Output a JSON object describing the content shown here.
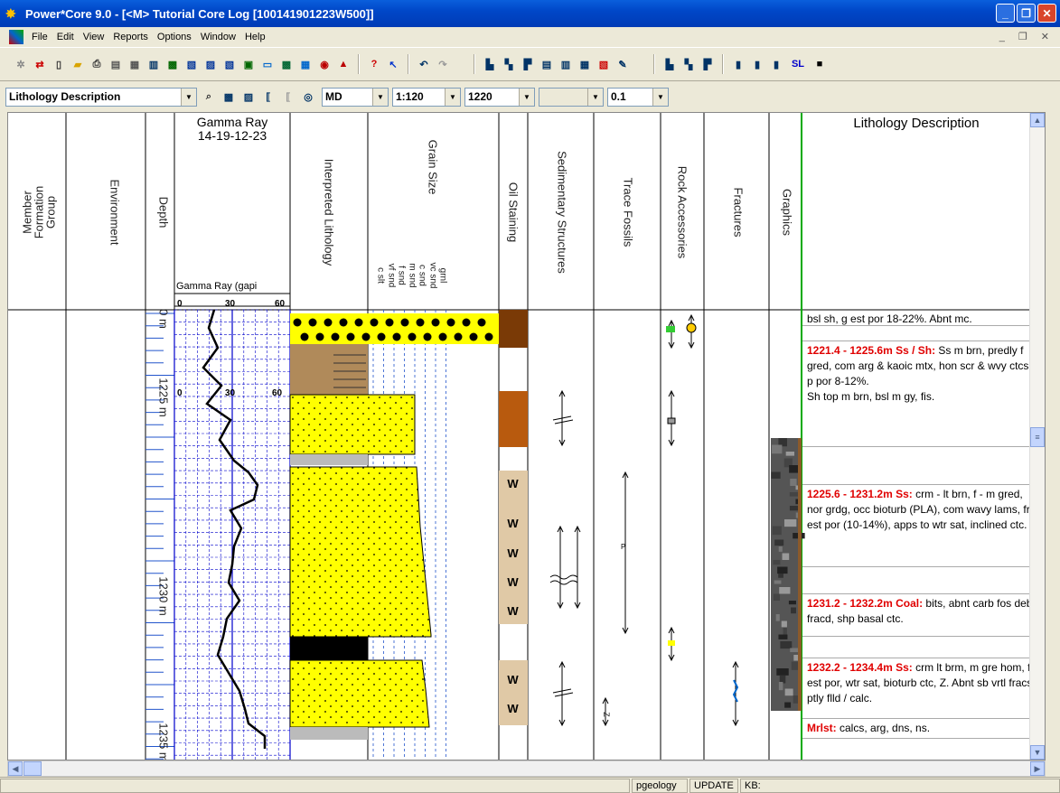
{
  "window": {
    "title": "Power*Core 9.0 - [<M> Tutorial Core Log [100141901223W500]]"
  },
  "menu": {
    "items": [
      "File",
      "Edit",
      "View",
      "Reports",
      "Options",
      "Window",
      "Help"
    ]
  },
  "toolbar2": {
    "view_select": "Lithology Description",
    "depth_mode": "MD",
    "scale": "1:120",
    "start_depth": "1220",
    "step_blank": "",
    "increment": "0.1"
  },
  "headers": {
    "group": "Member\nFormation\nGroup",
    "member": "Member",
    "formation": "Formation",
    "grp": "Group",
    "environment": "Environment",
    "depth": "Depth",
    "gamma_title": "Gamma Ray",
    "gamma_id": "14-19-12-23",
    "gamma_curve": "Gamma Ray (gapi",
    "gamma_min": "0",
    "gamma_mid": "30",
    "gamma_max": "60",
    "interp_lith": "Interpreted Lithology",
    "grain_size": "Grain Size",
    "grain_classes": [
      "c slt",
      "vf snd",
      "f snd",
      "m snd",
      "c snd",
      "vc snd",
      "grnl"
    ],
    "oil_staining": "Oil Staining",
    "sed_struct": "Sedimentary Structures",
    "trace_fossils": "Trace Fossils",
    "rock_acc": "Rock Accessories",
    "fractures": "Fractures",
    "graphics": "Graphics",
    "lith_desc": "Lithology Description"
  },
  "depth_labels": [
    "0 m",
    "1225 m",
    "1230 m",
    "1235 m"
  ],
  "gamma_inline": {
    "min": "0",
    "mid": "30",
    "max": "60"
  },
  "oil_stain_marks": [
    "W",
    "W",
    "W",
    "W",
    "W",
    "W",
    "W"
  ],
  "trace_label": "P",
  "trace_label2": "Z",
  "lithology_descriptions": [
    {
      "head": "",
      "text": "bsl sh, g est por 18-22%. Abnt mc."
    },
    {
      "head": "1221.4 - 1225.6m Ss / Sh:",
      "text": " Ss m brn, predly f gred, com arg & kaoic mtx, hon scr & wvy ctcs, p por 8-12%.\nSh top m brn, bsl m gy, fis."
    },
    {
      "head": "1225.6 - 1231.2m Ss:",
      "text": " crm - lt brn, f - m gred, nor grdg, occ bioturb (PLA), com wavy lams, fr est por (10-14%), apps to wtr sat, inclined ctc."
    },
    {
      "head": "1231.2 - 1232.2m Coal:",
      "text": " bits, abnt carb fos deb, fracd, shp basal ctc."
    },
    {
      "head": "1232.2 - 1234.4m Ss:",
      "text": " crm lt brm, m gre hom, fr est por, wtr sat, bioturb ctc, Z. Abnt sb vrtl fracs ptly flld / calc."
    },
    {
      "head": "Mrlst:",
      "text": " calcs, arg, dns, ns."
    }
  ],
  "status": {
    "user": "pgeology",
    "mode": "UPDATE",
    "kb": "KB:"
  },
  "colors": {
    "sandstone": "#ffff00",
    "shale_brown": "#b08a5a",
    "coal": "#000000",
    "oil_dark": "#7a3a06",
    "oil_med": "#b85a0e",
    "oil_light": "#e0c9a6",
    "gamma_grid": "#0000cc",
    "title_blue": "#0a5fdc"
  }
}
